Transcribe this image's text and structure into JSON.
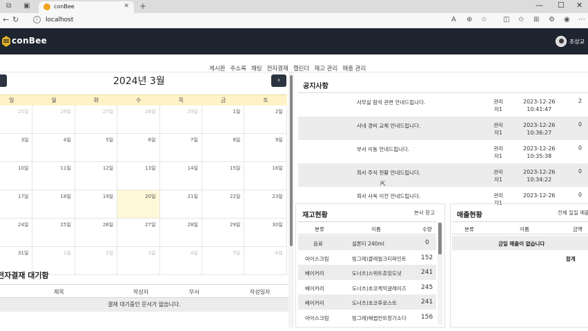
{
  "browser": {
    "tab_title": "conBee",
    "url": "localhost"
  },
  "app": {
    "logo_text": "conBee",
    "user_name": "조상교"
  },
  "menu": [
    "게시판",
    "주소록",
    "채팅",
    "전자결재",
    "캘린더",
    "재고 관리",
    "매출 관리"
  ],
  "calendar": {
    "title": "2024년 3월",
    "weekdays": [
      "일",
      "월",
      "화",
      "수",
      "목",
      "금",
      "토"
    ],
    "weeks": [
      [
        {
          "d": "25일",
          "dim": true
        },
        {
          "d": "26일",
          "dim": true
        },
        {
          "d": "27일",
          "dim": true
        },
        {
          "d": "28일",
          "dim": true
        },
        {
          "d": "29일",
          "dim": true
        },
        {
          "d": "1일"
        },
        {
          "d": "2일"
        }
      ],
      [
        {
          "d": "3일"
        },
        {
          "d": "4일"
        },
        {
          "d": "5일"
        },
        {
          "d": "6일"
        },
        {
          "d": "7일"
        },
        {
          "d": "8일"
        },
        {
          "d": "9일"
        }
      ],
      [
        {
          "d": "10일"
        },
        {
          "d": "11일"
        },
        {
          "d": "12일"
        },
        {
          "d": "13일"
        },
        {
          "d": "14일"
        },
        {
          "d": "15일"
        },
        {
          "d": "16일"
        }
      ],
      [
        {
          "d": "17일"
        },
        {
          "d": "18일"
        },
        {
          "d": "19일"
        },
        {
          "d": "20일",
          "today": true
        },
        {
          "d": "21일"
        },
        {
          "d": "22일"
        },
        {
          "d": "23일"
        }
      ],
      [
        {
          "d": "24일"
        },
        {
          "d": "25일"
        },
        {
          "d": "26일"
        },
        {
          "d": "27일"
        },
        {
          "d": "28일"
        },
        {
          "d": "29일"
        },
        {
          "d": "30일"
        }
      ],
      [
        {
          "d": "31일"
        },
        {
          "d": "1일",
          "dim": true
        },
        {
          "d": "2일",
          "dim": true
        },
        {
          "d": "3일",
          "dim": true
        },
        {
          "d": "4일",
          "dim": true
        },
        {
          "d": "5일",
          "dim": true
        },
        {
          "d": "6일",
          "dim": true
        }
      ]
    ]
  },
  "approval": {
    "title": "전자결재 대기함",
    "columns": [
      "제목",
      "작성자",
      "부서",
      "작성일자"
    ],
    "empty_text": "결재 대기중인 문서가 없습니다."
  },
  "notice": {
    "title": "공지사항",
    "rows": [
      {
        "subject": "사무실 함석 관련 안내드립니다.",
        "author": "관리자1",
        "date": "2023-12-26",
        "time": "10:41:47",
        "views": "2"
      },
      {
        "subject": "사내 경비 교체 안내드립니다.",
        "author": "관리자1",
        "date": "2023-12-26",
        "time": "10:36:27",
        "views": "0"
      },
      {
        "subject": "부서 이동 안내드립니다.",
        "author": "관리자1",
        "date": "2023-12-26",
        "time": "10:35:38",
        "views": "0"
      },
      {
        "subject": "회사 주식 현황 안내드립니다.",
        "author": "관리자1",
        "date": "2023-12-26",
        "time": "10:34:22",
        "views": "0"
      },
      {
        "subject": "회사 사옥 이전 안내드립니다.",
        "author": "관리자1",
        "date": "2023-12-26",
        "time": "",
        "views": "0"
      }
    ]
  },
  "inventory": {
    "title": "재고현황",
    "link": "본사 창고",
    "columns": [
      "분류",
      "이름",
      "수량"
    ],
    "rows": [
      {
        "cat": "음료",
        "name": "설론티 240ml",
        "qty": "0"
      },
      {
        "cat": "아이스크림",
        "name": "빙그레)클레월크티파인트",
        "qty": "152"
      },
      {
        "cat": "베이커리",
        "name": "도너츠)스위트츄잉도넛",
        "qty": "241"
      },
      {
        "cat": "베이커리",
        "name": "도너츠)초코케익글레이즈",
        "qty": "245"
      },
      {
        "cat": "베이커리",
        "name": "도너츠)초코후로스트",
        "qty": "241"
      },
      {
        "cat": "아이스크림",
        "name": "빙그레)해썹컨트랑기소다",
        "qty": "156"
      }
    ]
  },
  "sales": {
    "title": "매출현황",
    "filter": "전체 일일 매출",
    "columns": [
      "분류",
      "이름",
      "금액"
    ],
    "empty_text": "금일 매출이 없습니다",
    "total_label": "합계"
  }
}
